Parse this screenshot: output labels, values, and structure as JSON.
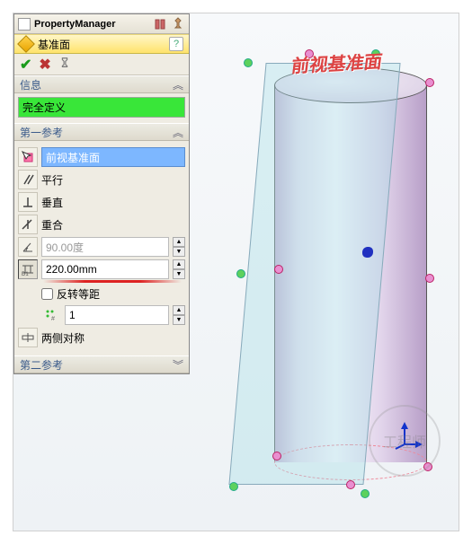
{
  "titlebar": {
    "title": "PropertyManager"
  },
  "feature": {
    "name": "基准面"
  },
  "info": {
    "header": "信息",
    "status": "完全定义"
  },
  "ref1": {
    "header": "第一参考",
    "selection": "前视基准面",
    "parallel": "平行",
    "perpendicular": "垂直",
    "coincident": "重合",
    "angle": "90.00度",
    "distance": "220.00mm",
    "reverse": "反转等距",
    "instances": "1",
    "bothsides": "两侧对称"
  },
  "ref2": {
    "header": "第二参考"
  },
  "viewport": {
    "annotation": "前视基准面",
    "watermark": "工程师"
  }
}
